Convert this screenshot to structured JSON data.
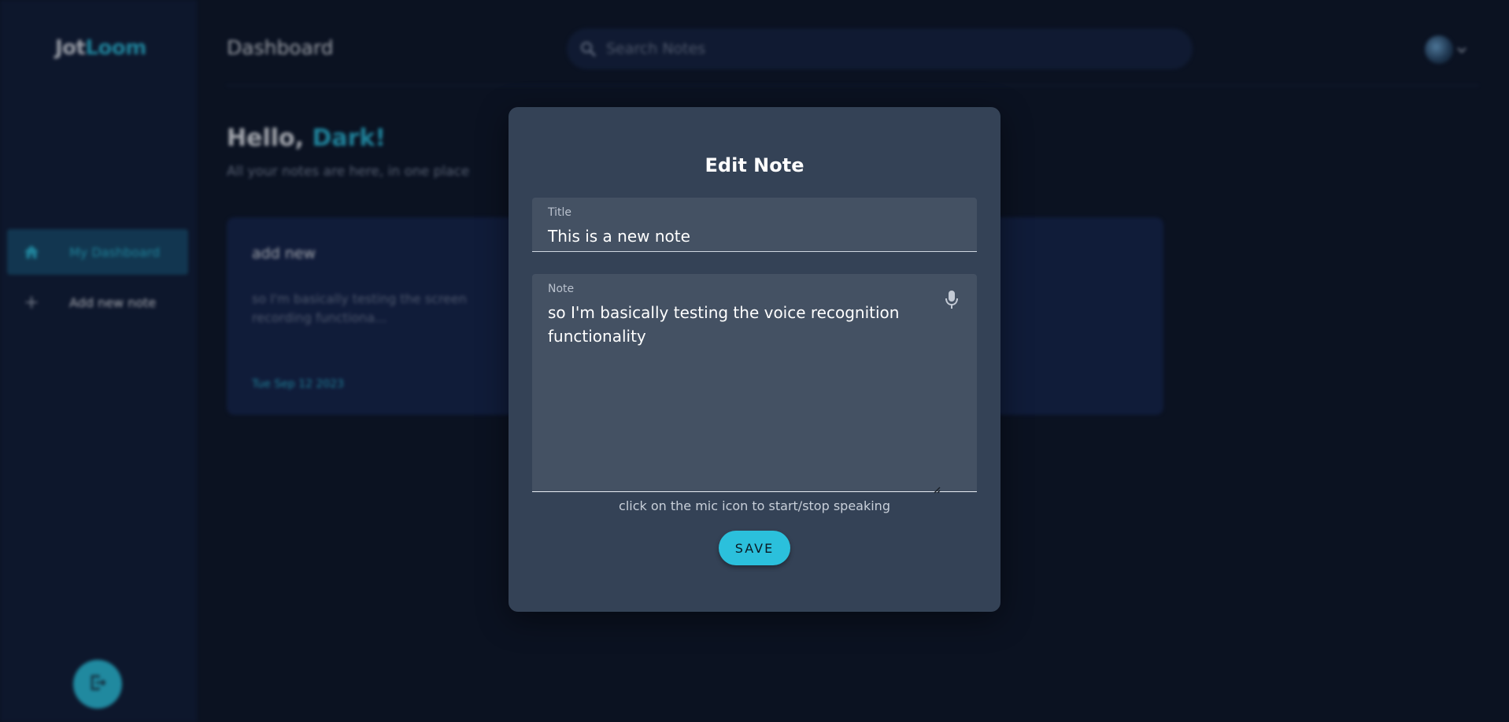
{
  "app": {
    "logo_part1": "Jot",
    "logo_part2": "Loom",
    "page_title": "Dashboard",
    "accent_color": "#2bc0dc"
  },
  "sidebar": {
    "items": [
      {
        "label": "My Dashboard",
        "icon": "home-icon",
        "active": true
      },
      {
        "label": "Add new note",
        "icon": "plus-icon",
        "active": false
      }
    ],
    "logout_icon": "logout-icon"
  },
  "search": {
    "placeholder": "Search Notes"
  },
  "greeting": {
    "hello": "Hello, ",
    "name": "Dark!",
    "subtitle": "All your notes are here, in one place"
  },
  "notes": [
    {
      "title": "add new",
      "snippet": "so I'm basically testing the screen recording functiona...",
      "date": "Tue Sep 12 2023"
    }
  ],
  "modal": {
    "heading": "Edit Note",
    "title_label": "Title",
    "title_value": "This is a new note",
    "note_label": "Note",
    "note_value": "so I'm basically testing the voice recognition functionality",
    "helper": "click on the mic icon to start/stop speaking",
    "save_label": "SAVE"
  }
}
